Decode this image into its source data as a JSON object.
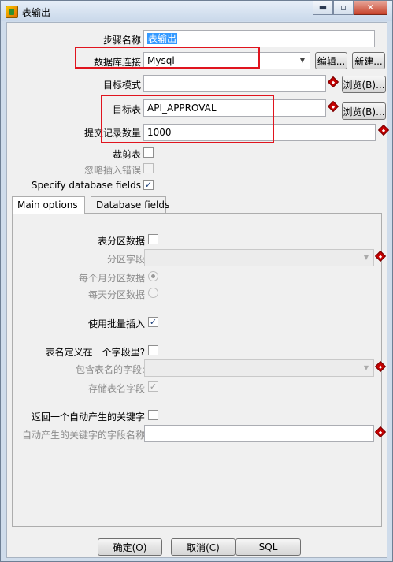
{
  "window": {
    "title": "表输出",
    "controls": {
      "minimize": "▬",
      "maximize": "▫",
      "close": "✕"
    }
  },
  "form": {
    "step_name_label": "步骤名称",
    "step_name_value": "表输出",
    "connection_label": "数据库连接",
    "connection_value": "Mysql",
    "edit_button": "编辑...",
    "new_button": "新建...",
    "schema_label": "目标模式",
    "schema_value": "",
    "browse_button": "浏览(B)...",
    "table_label": "目标表",
    "table_value": "API_APPROVAL",
    "commit_label": "提交记录数量",
    "commit_value": "1000",
    "truncate_label": "裁剪表",
    "truncate_checked": "",
    "ignore_errors_label": "忽略插入错误",
    "ignore_errors_checked": "",
    "specify_fields_label": "Specify database fields",
    "specify_fields_checked": "✓"
  },
  "tabs": [
    {
      "label": "Main options",
      "active": true
    },
    {
      "label": "Database fields",
      "active": false
    }
  ],
  "main_options": {
    "partition_label": "表分区数据",
    "partition_checked": "",
    "partition_field_label": "分区字段",
    "partition_field_value": "",
    "partition_monthly_label": "每个月分区数据",
    "partition_daily_label": "每天分区数据",
    "batch_insert_label": "使用批量插入",
    "batch_insert_checked": "✓",
    "table_in_field_label": "表名定义在一个字段里?",
    "table_in_field_checked": "",
    "table_name_field_label": "包含表名的字段:",
    "table_name_field_value": "",
    "store_table_name_label": "存储表名字段",
    "store_table_name_checked": "✓",
    "return_key_label": "返回一个自动产生的关键字",
    "return_key_checked": "",
    "key_field_name_label": "自动产生的关键字的字段名称",
    "key_field_name_value": ""
  },
  "footer": {
    "ok_button": "确定(O)",
    "cancel_button": "取消(C)",
    "sql_button": "SQL"
  },
  "colors": {
    "highlight_box": "#e0141e",
    "required_marker": "#c40000",
    "selection": "#3399ff"
  }
}
